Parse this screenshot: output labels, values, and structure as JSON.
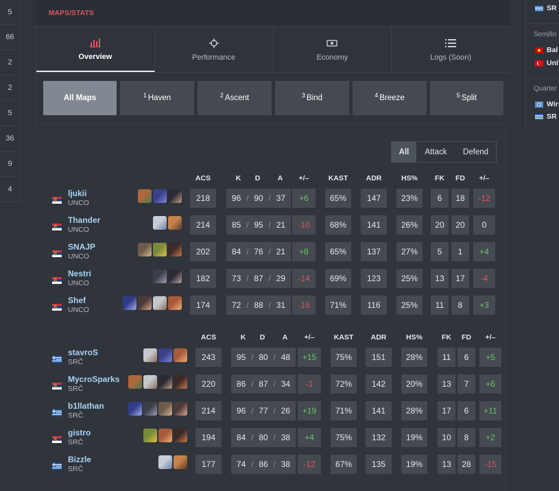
{
  "left_column": [
    "5",
    "66",
    "2",
    "2",
    "5",
    "36",
    "9",
    "4"
  ],
  "section_title": "MAPS/STATS",
  "tabs": [
    {
      "label": "Overview",
      "icon": "bar-chart-icon",
      "active": true
    },
    {
      "label": "Performance",
      "icon": "crosshair-icon",
      "active": false
    },
    {
      "label": "Economy",
      "icon": "money-icon",
      "active": false
    },
    {
      "label": "Logs (Soon)",
      "icon": "list-icon",
      "active": false
    }
  ],
  "maps": [
    {
      "num": "",
      "label": "All Maps",
      "active": true
    },
    {
      "num": "1",
      "label": "Haven",
      "active": false
    },
    {
      "num": "2",
      "label": "Ascent",
      "active": false
    },
    {
      "num": "3",
      "label": "Bind",
      "active": false
    },
    {
      "num": "4",
      "label": "Breeze",
      "active": false
    },
    {
      "num": "5",
      "label": "Split",
      "active": false
    }
  ],
  "side_filter": {
    "all": "All",
    "attack": "Attack",
    "defend": "Defend"
  },
  "columns": {
    "acs": "ACS",
    "k": "K",
    "d": "D",
    "a": "A",
    "pm": "+/–",
    "kast": "KAST",
    "adr": "ADR",
    "hs": "HS%",
    "fk": "FK",
    "fd": "FD",
    "fpm": "+/–"
  },
  "team1": [
    {
      "name": "ljukii",
      "team": "UNCO",
      "flag": "rs",
      "agents": [
        "agent-a",
        "agent-b",
        "agent-c"
      ],
      "acs": "218",
      "k": "96",
      "d": "90",
      "a": "37",
      "pm": "+6",
      "kast": "65%",
      "adr": "147",
      "hs": "23%",
      "fk": "6",
      "fd": "18",
      "fpm": "-12"
    },
    {
      "name": "Thander",
      "team": "UNCO",
      "flag": "rs",
      "agents": [
        "agent-d",
        "agent-e"
      ],
      "acs": "214",
      "k": "85",
      "d": "95",
      "a": "21",
      "pm": "-10",
      "kast": "68%",
      "adr": "141",
      "hs": "26%",
      "fk": "20",
      "fd": "20",
      "fpm": "0"
    },
    {
      "name": "SNAJP",
      "team": "UNCO",
      "flag": "rs",
      "agents": [
        "agent-f",
        "agent-g",
        "agent-h"
      ],
      "acs": "202",
      "k": "84",
      "d": "76",
      "a": "21",
      "pm": "+8",
      "kast": "65%",
      "adr": "137",
      "hs": "27%",
      "fk": "5",
      "fd": "1",
      "fpm": "+4"
    },
    {
      "name": "Nestri",
      "team": "UNCO",
      "flag": "rs",
      "agents": [
        "agent-i",
        "agent-j"
      ],
      "acs": "182",
      "k": "73",
      "d": "87",
      "a": "29",
      "pm": "-14",
      "kast": "69%",
      "adr": "123",
      "hs": "25%",
      "fk": "13",
      "fd": "17",
      "fpm": "-4"
    },
    {
      "name": "Shef",
      "team": "UNCO",
      "flag": "rs",
      "agents": [
        "agent-k",
        "agent-l",
        "agent-m",
        "agent-n"
      ],
      "acs": "174",
      "k": "72",
      "d": "88",
      "a": "31",
      "pm": "-16",
      "kast": "71%",
      "adr": "116",
      "hs": "25%",
      "fk": "11",
      "fd": "8",
      "fpm": "+3"
    }
  ],
  "team2": [
    {
      "name": "stavroS",
      "team": "SRČ",
      "flag": "gr",
      "agents": [
        "agent-m",
        "agent-b",
        "agent-n"
      ],
      "acs": "243",
      "k": "95",
      "d": "80",
      "a": "48",
      "pm": "+15",
      "kast": "75%",
      "adr": "151",
      "hs": "28%",
      "fk": "11",
      "fd": "6",
      "fpm": "+5"
    },
    {
      "name": "MycroSparks",
      "team": "SRČ",
      "flag": "rs",
      "agents": [
        "agent-a",
        "agent-m",
        "agent-c",
        "agent-h"
      ],
      "acs": "220",
      "k": "86",
      "d": "87",
      "a": "34",
      "pm": "-1",
      "kast": "72%",
      "adr": "142",
      "hs": "20%",
      "fk": "13",
      "fd": "7",
      "fpm": "+6"
    },
    {
      "name": "b1llathan",
      "team": "SRČ",
      "flag": "gr",
      "agents": [
        "agent-k",
        "agent-i",
        "agent-f",
        "agent-l"
      ],
      "acs": "214",
      "k": "96",
      "d": "77",
      "a": "26",
      "pm": "+19",
      "kast": "71%",
      "adr": "141",
      "hs": "28%",
      "fk": "17",
      "fd": "6",
      "fpm": "+11"
    },
    {
      "name": "gistro",
      "team": "SRČ",
      "flag": "rs",
      "agents": [
        "agent-g",
        "agent-n",
        "agent-h"
      ],
      "acs": "194",
      "k": "84",
      "d": "80",
      "a": "38",
      "pm": "+4",
      "kast": "75%",
      "adr": "132",
      "hs": "19%",
      "fk": "10",
      "fd": "8",
      "fpm": "+2"
    },
    {
      "name": "Bizzle",
      "team": "SRČ",
      "flag": "gr",
      "agents": [
        "agent-d",
        "agent-e"
      ],
      "acs": "177",
      "k": "74",
      "d": "86",
      "a": "38",
      "pm": "-12",
      "kast": "67%",
      "adr": "135",
      "hs": "19%",
      "fk": "13",
      "fd": "28",
      "fpm": "-15"
    }
  ],
  "right_panel": {
    "top_team": "SR",
    "semifinals_label": "Semifin",
    "semifinal_teams": [
      "Bal",
      "Unl"
    ],
    "quarterfinals_label": "Quarter",
    "quarterfinal_teams": [
      "Wir",
      "SR"
    ]
  },
  "colors": {
    "positive": "#68c565",
    "negative": "#e0545f",
    "accent": "#e0545f",
    "player_name": "#a9d2f3"
  }
}
